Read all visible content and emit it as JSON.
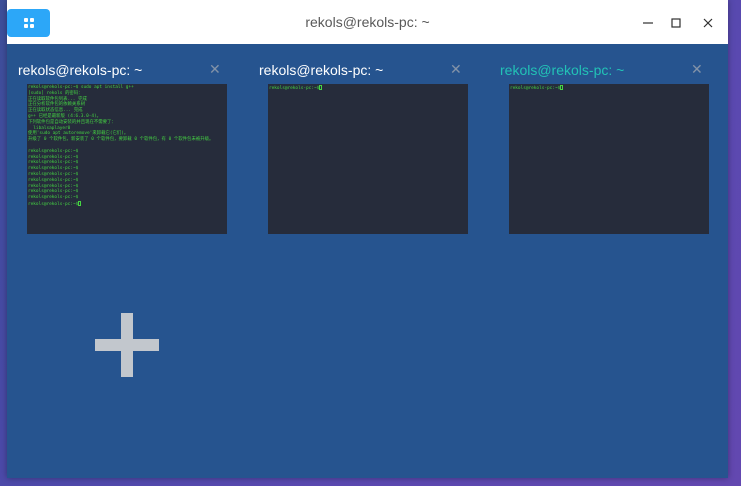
{
  "window": {
    "title": "rekols@rekols-pc: ~",
    "menu_icon": "grid-menu-icon",
    "minimize_icon": "minimize-icon",
    "maximize_icon": "maximize-icon",
    "close_icon": "close-icon",
    "accent_color": "#2ca7f8",
    "background_color": "#26548f"
  },
  "panels": [
    {
      "title": "rekols@rekols-pc: ~",
      "close_glyph": "✕",
      "active": false,
      "lines": [
        "rekols@rekols-pc:~$ sudo apt install g++",
        "[sudo] rekols 的密码：",
        "正在读取软件包列表... 完成",
        "正在分析软件包的依赖关系树",
        "正在读取状态信息... 完成",
        "g++ 已经是最新版 (4:6.3.0-4)。",
        "下列软件包是自动安装的并且现在不需要了：",
        "  libalsaplayer0",
        "使用'sudo apt autoremove'来卸载它(它们)。",
        "升级了 0 个软件包，新安装了 0 个软件包，要卸载 0 个软件包，有 0 个软件包未被升级。",
        "",
        "rekols@rekols-pc:~$",
        "rekols@rekols-pc:~$",
        "rekols@rekols-pc:~$",
        "rekols@rekols-pc:~$",
        "rekols@rekols-pc:~$",
        "rekols@rekols-pc:~$",
        "rekols@rekols-pc:~$",
        "rekols@rekols-pc:~$",
        "rekols@rekols-pc:~$",
        "rekols@rekols-pc:~$"
      ]
    },
    {
      "title": "rekols@rekols-pc: ~",
      "close_glyph": "✕",
      "active": false,
      "lines": [
        "rekols@rekols-pc:~$"
      ]
    },
    {
      "title": "rekols@rekols-pc: ~",
      "close_glyph": "✕",
      "active": true,
      "lines": [
        "rekols@rekols-pc:~$"
      ]
    }
  ],
  "add_workspace": {
    "icon": "plus-icon"
  }
}
